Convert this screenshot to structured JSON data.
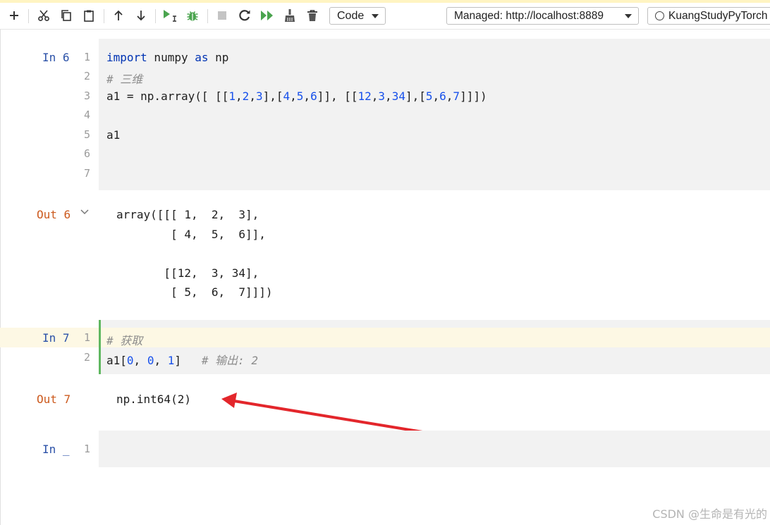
{
  "toolbar": {
    "cell_type": "Code",
    "server": "Managed: http://localhost:8889",
    "kernel": "KuangStudyPyTorch"
  },
  "cells": [
    {
      "prompt": "In 6",
      "line_numbers": [
        "1",
        "2",
        "3",
        "4",
        "5",
        "6",
        "7"
      ],
      "code": {
        "line1_kw1": "import",
        "line1_mid": " numpy ",
        "line1_kw2": "as",
        "line1_end": " np",
        "line2_comment": "# 三维",
        "line3": {
          "p1": "a1 = np.array([ [[",
          "n1": "1",
          "c1": ",",
          "n2": "2",
          "c2": ",",
          "n3": "3",
          "p2": "],[",
          "n4": "4",
          "c3": ",",
          "n5": "5",
          "c4": ",",
          "n6": "6",
          "p3": "]], [[",
          "n7": "12",
          "c5": ",",
          "n8": "3",
          "c6": ",",
          "n9": "34",
          "p4": "],[",
          "n10": "5",
          "c7": ",",
          "n11": "6",
          "c8": ",",
          "n12": "7",
          "p5": "]]])"
        },
        "line5": "a1"
      }
    },
    {
      "prompt": "Out 6",
      "output_lines": [
        "array([[[ 1,  2,  3],",
        "        [ 4,  5,  6]],",
        "",
        "       [[12,  3, 34],",
        "        [ 5,  6,  7]]])"
      ]
    },
    {
      "prompt": "In 7",
      "line_numbers": [
        "1",
        "2"
      ],
      "code": {
        "line1_comment": "# 获取",
        "line2": {
          "p1": "a1[",
          "n1": "0",
          "c1": ", ",
          "n2": "0",
          "c2": ", ",
          "n3": "1",
          "p2": "]   ",
          "comment": "# 输出: 2"
        }
      }
    },
    {
      "prompt": "Out 7",
      "output": "np.int64(2)"
    },
    {
      "prompt": "In _",
      "line_numbers": [
        "1"
      ]
    }
  ],
  "colors": {
    "prompt_in": "#2c52a8",
    "prompt_out": "#cc5a1e",
    "keyword": "#0033b3",
    "number": "#1750eb",
    "comment": "#8c8c8c",
    "active_cell_bar": "#5fb760",
    "annotation_arrow": "#e3262b"
  },
  "watermark": "CSDN @生命是有光的"
}
